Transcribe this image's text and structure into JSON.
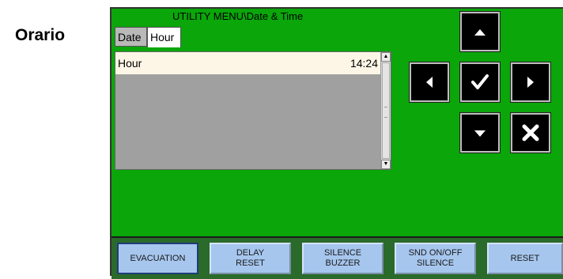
{
  "side_title": "Orario",
  "panel": {
    "menu_title": "UTILITY MENU\\Date & Time",
    "tabs": [
      {
        "label": "Date",
        "active": false
      },
      {
        "label": "Hour",
        "active": true
      }
    ],
    "list": {
      "rows": [
        {
          "label": "Hour",
          "value": "14:24"
        }
      ],
      "scroll_up_icon": "▲",
      "scroll_down_icon": "▼"
    }
  },
  "nav_buttons": {
    "up": "arrow-up-icon",
    "left": "arrow-left-icon",
    "ok": "checkmark-icon",
    "right": "arrow-right-icon",
    "down": "arrow-down-icon",
    "cancel": "cross-icon"
  },
  "function_keys": [
    {
      "line1": "EVACUATION",
      "line2": "",
      "selected": true
    },
    {
      "line1": "DELAY",
      "line2": "RESET",
      "selected": false
    },
    {
      "line1": "SILENCE",
      "line2": "BUZZER",
      "selected": false
    },
    {
      "line1": "SND ON/OFF",
      "line2": "SILENCE",
      "selected": false
    },
    {
      "line1": "RESET",
      "line2": "",
      "selected": false
    }
  ],
  "colors": {
    "panel_bg": "#0aa60a",
    "list_bg": "#a0a0a0",
    "row_highlight": "#fdf6e6",
    "button_bg": "#000000",
    "fkey_bg": "#a6c6ee"
  }
}
